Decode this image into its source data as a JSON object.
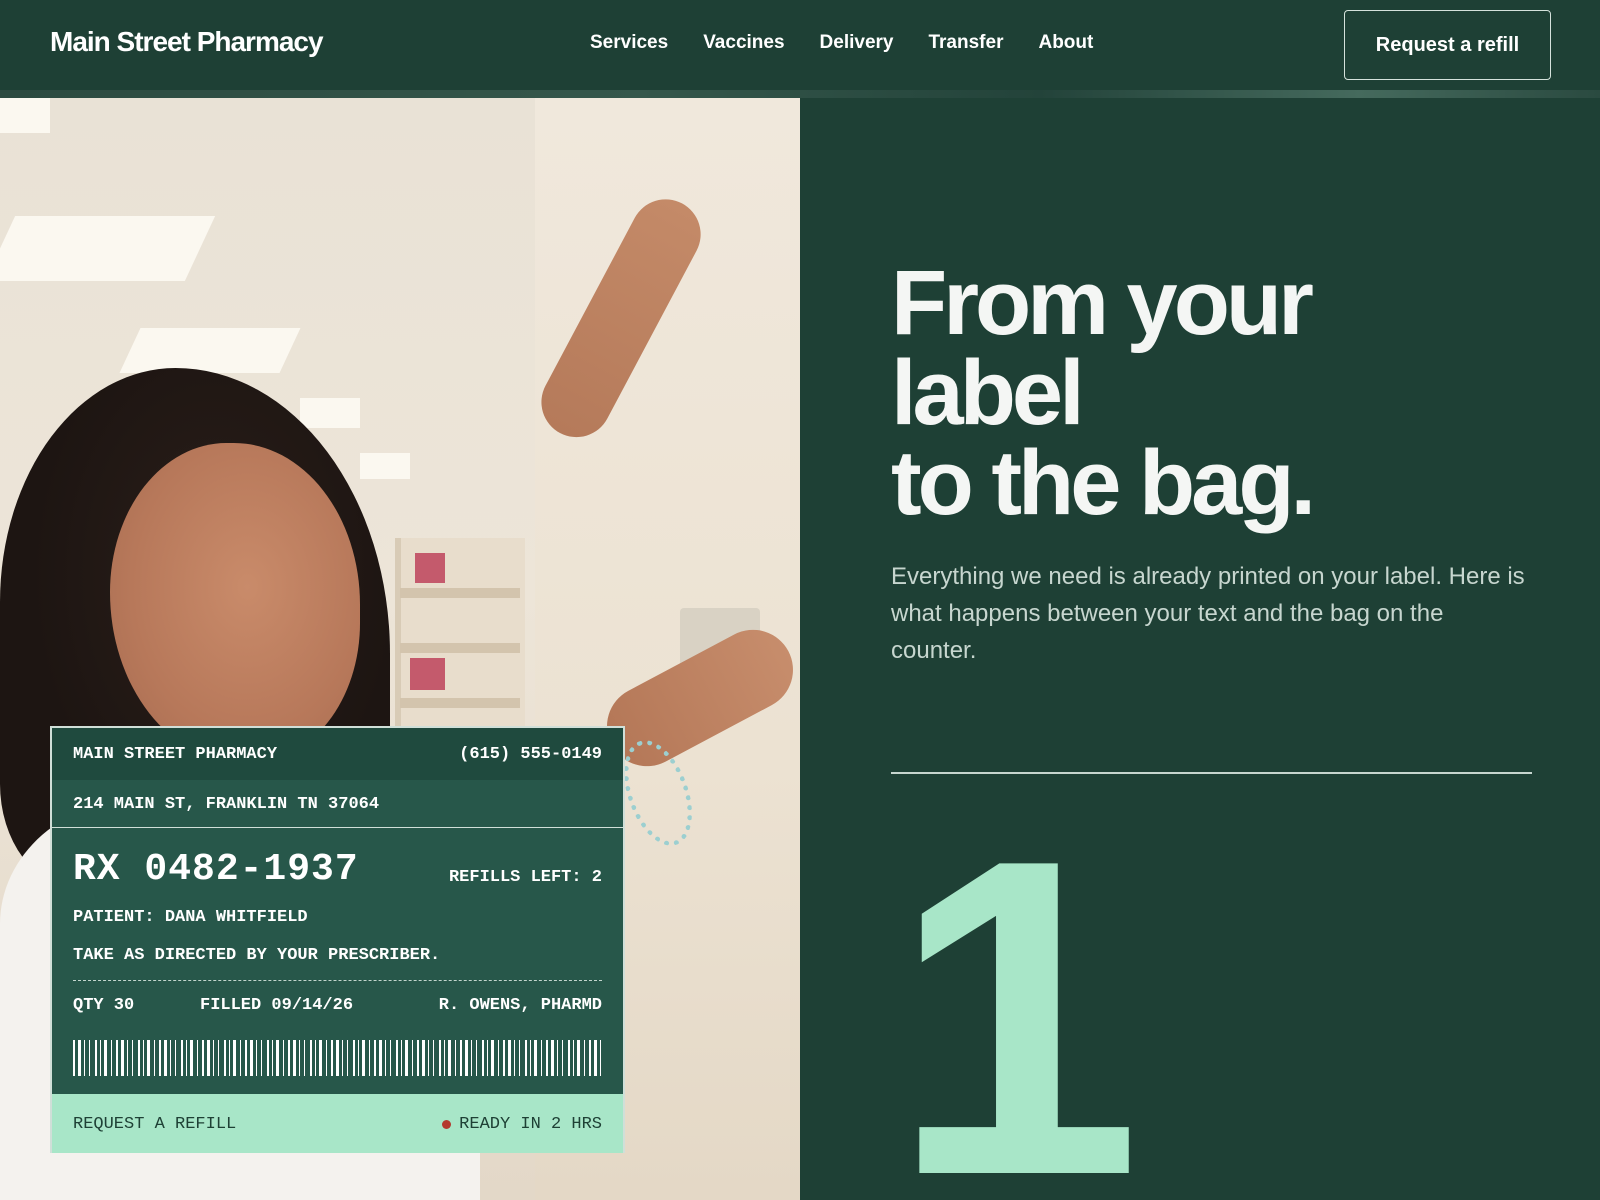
{
  "nav": {
    "logo": "Main Street Pharmacy",
    "links": [
      "Services",
      "Vaccines",
      "Delivery",
      "Transfer",
      "About"
    ],
    "cta": "Request a refill"
  },
  "label": {
    "pharmacy_name": "MAIN STREET PHARMACY",
    "phone": "(615) 555-0149",
    "address": "214 MAIN ST, FRANKLIN TN 37064",
    "rx_number": "RX 0482-1937",
    "refills_left": "REFILLS LEFT: 2",
    "patient": "PATIENT: DANA WHITFIELD",
    "directions": "TAKE AS DIRECTED BY YOUR PRESCRIBER.",
    "qty": "QTY 30",
    "filled": "FILLED 09/14/26",
    "pharmacist": "R. OWENS, PHARMD",
    "footer_action": "REQUEST A REFILL",
    "status": "READY IN 2 HRS",
    "status_color": "#b43a2f"
  },
  "hero": {
    "headline_lines": [
      "From your",
      "label",
      "to the bag."
    ],
    "subtext": "Everything we need is already printed on your label. Here is what happens between your text and the bag on the counter.",
    "step_number": "1"
  },
  "colors": {
    "background": "#1e4035",
    "accent": "#a8e6c8",
    "label_body": "#27574a"
  },
  "icons": {
    "barcode": "barcode-icon",
    "status": "status-dot-icon"
  }
}
